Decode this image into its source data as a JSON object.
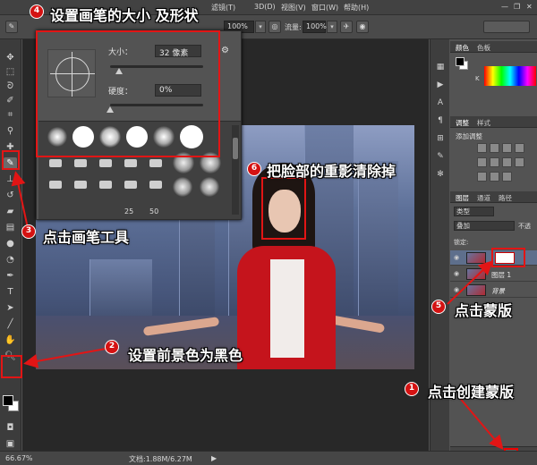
{
  "menubar": {
    "items": [
      "滤镜(T)",
      "3D(D)",
      "视图(V)",
      "窗口(W)",
      "帮助(H)"
    ]
  },
  "options": {
    "opacity_value": "100%",
    "flow_label": "流量:",
    "flow_value": "100%"
  },
  "brush_panel": {
    "size_label": "大小：",
    "size_value": "32 像素",
    "hardness_label": "硬度：",
    "hardness_value": "0%",
    "size_slider_level": 0.1,
    "hardness_slider_level": 0.0,
    "preset_numbers": [
      "25",
      "50"
    ]
  },
  "right_panels": {
    "color_tabs": [
      "颜色",
      "色板"
    ],
    "adjust_tabs": [
      "调整",
      "样式"
    ],
    "adjust_title": "添加调整",
    "layer_tabs": [
      "图层",
      "通道",
      "路径"
    ],
    "kind_filter": "类型",
    "blend_mode": "叠加",
    "opacity_label": "不透",
    "lock_label": "锁定:",
    "layers": [
      {
        "name": "",
        "has_mask": true,
        "selected": true
      },
      {
        "name": "图层 1",
        "has_mask": false,
        "selected": false
      },
      {
        "name": "背景",
        "has_mask": false,
        "selected": false
      }
    ]
  },
  "status": {
    "zoom": "66.67%",
    "doc_info": "文档:1.88M/6.27M"
  },
  "annotations": {
    "step1": {
      "num": "1",
      "text": "点击创建蒙版"
    },
    "step2": {
      "num": "2",
      "text": "设置前景色为黑色"
    },
    "step3": {
      "num": "3",
      "text": "点击画笔工具"
    },
    "step4": {
      "num": "4",
      "text": "设置画笔的大小 及形状"
    },
    "step5": {
      "num": "5",
      "text": "点击蒙版"
    },
    "step6": {
      "num": "6",
      "text": "把脸部的重影清除掉"
    }
  },
  "colors": {
    "annotation_red": "#e21515",
    "foreground": "#000000",
    "background": "#ffffff",
    "coat_red": "#c5141c"
  }
}
